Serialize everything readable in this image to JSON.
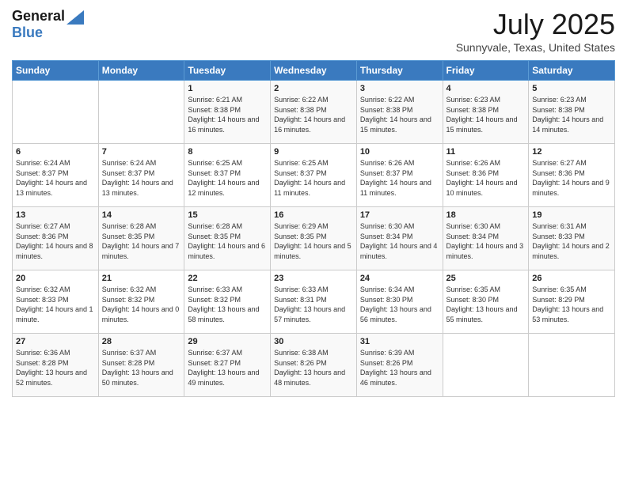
{
  "header": {
    "logo_general": "General",
    "logo_blue": "Blue",
    "month_title": "July 2025",
    "location": "Sunnyvale, Texas, United States"
  },
  "days_of_week": [
    "Sunday",
    "Monday",
    "Tuesday",
    "Wednesday",
    "Thursday",
    "Friday",
    "Saturday"
  ],
  "weeks": [
    [
      {
        "day": "",
        "sunrise": "",
        "sunset": "",
        "daylight": ""
      },
      {
        "day": "",
        "sunrise": "",
        "sunset": "",
        "daylight": ""
      },
      {
        "day": "1",
        "sunrise": "Sunrise: 6:21 AM",
        "sunset": "Sunset: 8:38 PM",
        "daylight": "Daylight: 14 hours and 16 minutes."
      },
      {
        "day": "2",
        "sunrise": "Sunrise: 6:22 AM",
        "sunset": "Sunset: 8:38 PM",
        "daylight": "Daylight: 14 hours and 16 minutes."
      },
      {
        "day": "3",
        "sunrise": "Sunrise: 6:22 AM",
        "sunset": "Sunset: 8:38 PM",
        "daylight": "Daylight: 14 hours and 15 minutes."
      },
      {
        "day": "4",
        "sunrise": "Sunrise: 6:23 AM",
        "sunset": "Sunset: 8:38 PM",
        "daylight": "Daylight: 14 hours and 15 minutes."
      },
      {
        "day": "5",
        "sunrise": "Sunrise: 6:23 AM",
        "sunset": "Sunset: 8:38 PM",
        "daylight": "Daylight: 14 hours and 14 minutes."
      }
    ],
    [
      {
        "day": "6",
        "sunrise": "Sunrise: 6:24 AM",
        "sunset": "Sunset: 8:37 PM",
        "daylight": "Daylight: 14 hours and 13 minutes."
      },
      {
        "day": "7",
        "sunrise": "Sunrise: 6:24 AM",
        "sunset": "Sunset: 8:37 PM",
        "daylight": "Daylight: 14 hours and 13 minutes."
      },
      {
        "day": "8",
        "sunrise": "Sunrise: 6:25 AM",
        "sunset": "Sunset: 8:37 PM",
        "daylight": "Daylight: 14 hours and 12 minutes."
      },
      {
        "day": "9",
        "sunrise": "Sunrise: 6:25 AM",
        "sunset": "Sunset: 8:37 PM",
        "daylight": "Daylight: 14 hours and 11 minutes."
      },
      {
        "day": "10",
        "sunrise": "Sunrise: 6:26 AM",
        "sunset": "Sunset: 8:37 PM",
        "daylight": "Daylight: 14 hours and 11 minutes."
      },
      {
        "day": "11",
        "sunrise": "Sunrise: 6:26 AM",
        "sunset": "Sunset: 8:36 PM",
        "daylight": "Daylight: 14 hours and 10 minutes."
      },
      {
        "day": "12",
        "sunrise": "Sunrise: 6:27 AM",
        "sunset": "Sunset: 8:36 PM",
        "daylight": "Daylight: 14 hours and 9 minutes."
      }
    ],
    [
      {
        "day": "13",
        "sunrise": "Sunrise: 6:27 AM",
        "sunset": "Sunset: 8:36 PM",
        "daylight": "Daylight: 14 hours and 8 minutes."
      },
      {
        "day": "14",
        "sunrise": "Sunrise: 6:28 AM",
        "sunset": "Sunset: 8:35 PM",
        "daylight": "Daylight: 14 hours and 7 minutes."
      },
      {
        "day": "15",
        "sunrise": "Sunrise: 6:28 AM",
        "sunset": "Sunset: 8:35 PM",
        "daylight": "Daylight: 14 hours and 6 minutes."
      },
      {
        "day": "16",
        "sunrise": "Sunrise: 6:29 AM",
        "sunset": "Sunset: 8:35 PM",
        "daylight": "Daylight: 14 hours and 5 minutes."
      },
      {
        "day": "17",
        "sunrise": "Sunrise: 6:30 AM",
        "sunset": "Sunset: 8:34 PM",
        "daylight": "Daylight: 14 hours and 4 minutes."
      },
      {
        "day": "18",
        "sunrise": "Sunrise: 6:30 AM",
        "sunset": "Sunset: 8:34 PM",
        "daylight": "Daylight: 14 hours and 3 minutes."
      },
      {
        "day": "19",
        "sunrise": "Sunrise: 6:31 AM",
        "sunset": "Sunset: 8:33 PM",
        "daylight": "Daylight: 14 hours and 2 minutes."
      }
    ],
    [
      {
        "day": "20",
        "sunrise": "Sunrise: 6:32 AM",
        "sunset": "Sunset: 8:33 PM",
        "daylight": "Daylight: 14 hours and 1 minute."
      },
      {
        "day": "21",
        "sunrise": "Sunrise: 6:32 AM",
        "sunset": "Sunset: 8:32 PM",
        "daylight": "Daylight: 14 hours and 0 minutes."
      },
      {
        "day": "22",
        "sunrise": "Sunrise: 6:33 AM",
        "sunset": "Sunset: 8:32 PM",
        "daylight": "Daylight: 13 hours and 58 minutes."
      },
      {
        "day": "23",
        "sunrise": "Sunrise: 6:33 AM",
        "sunset": "Sunset: 8:31 PM",
        "daylight": "Daylight: 13 hours and 57 minutes."
      },
      {
        "day": "24",
        "sunrise": "Sunrise: 6:34 AM",
        "sunset": "Sunset: 8:30 PM",
        "daylight": "Daylight: 13 hours and 56 minutes."
      },
      {
        "day": "25",
        "sunrise": "Sunrise: 6:35 AM",
        "sunset": "Sunset: 8:30 PM",
        "daylight": "Daylight: 13 hours and 55 minutes."
      },
      {
        "day": "26",
        "sunrise": "Sunrise: 6:35 AM",
        "sunset": "Sunset: 8:29 PM",
        "daylight": "Daylight: 13 hours and 53 minutes."
      }
    ],
    [
      {
        "day": "27",
        "sunrise": "Sunrise: 6:36 AM",
        "sunset": "Sunset: 8:28 PM",
        "daylight": "Daylight: 13 hours and 52 minutes."
      },
      {
        "day": "28",
        "sunrise": "Sunrise: 6:37 AM",
        "sunset": "Sunset: 8:28 PM",
        "daylight": "Daylight: 13 hours and 50 minutes."
      },
      {
        "day": "29",
        "sunrise": "Sunrise: 6:37 AM",
        "sunset": "Sunset: 8:27 PM",
        "daylight": "Daylight: 13 hours and 49 minutes."
      },
      {
        "day": "30",
        "sunrise": "Sunrise: 6:38 AM",
        "sunset": "Sunset: 8:26 PM",
        "daylight": "Daylight: 13 hours and 48 minutes."
      },
      {
        "day": "31",
        "sunrise": "Sunrise: 6:39 AM",
        "sunset": "Sunset: 8:26 PM",
        "daylight": "Daylight: 13 hours and 46 minutes."
      },
      {
        "day": "",
        "sunrise": "",
        "sunset": "",
        "daylight": ""
      },
      {
        "day": "",
        "sunrise": "",
        "sunset": "",
        "daylight": ""
      }
    ]
  ]
}
